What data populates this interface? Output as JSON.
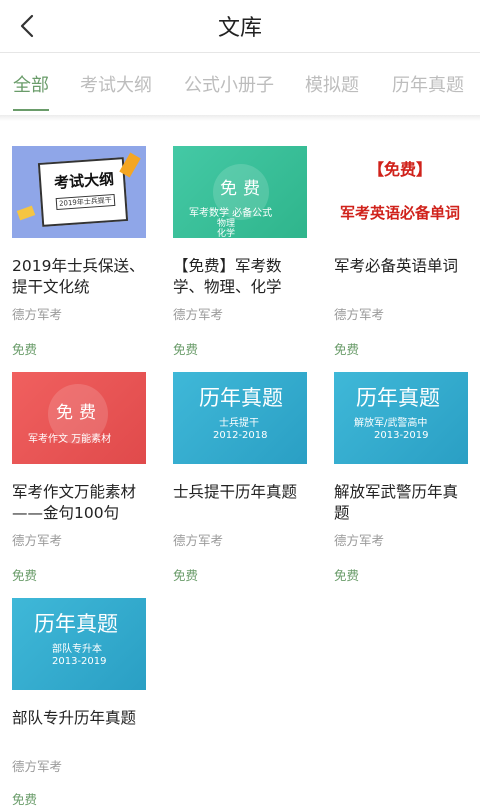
{
  "header": {
    "title": "文库"
  },
  "tabs": [
    {
      "label": "全部"
    },
    {
      "label": "考试大纲"
    },
    {
      "label": "公式小册子"
    },
    {
      "label": "模拟题"
    },
    {
      "label": "历年真题"
    }
  ],
  "items": [
    {
      "title": "2019年士兵保送、提干文化统",
      "publisher": "德方军考",
      "price": "免费",
      "cover": {
        "big": "考试大纲",
        "sub": "2019年士兵提干"
      }
    },
    {
      "title": "【免费】军考数学、物理、化学",
      "publisher": "德方军考",
      "price": "免费",
      "cover": {
        "big": "免费",
        "line1": "军考数学  必备公式",
        "line2": "物理",
        "line3": "化学"
      }
    },
    {
      "title": "军考必备英语单词",
      "publisher": "德方军考",
      "price": "免费",
      "cover": {
        "big": "【免费】",
        "sub": "军考英语必备单词"
      }
    },
    {
      "title": "军考作文万能素材——金句100句",
      "publisher": "德方军考",
      "price": "免费",
      "cover": {
        "big": "免费",
        "sub": "军考作文  万能素材"
      }
    },
    {
      "title": "士兵提干历年真题",
      "publisher": "德方军考",
      "price": "免费",
      "cover": {
        "big": "历年真题",
        "line1": "士兵提干",
        "line2": "2012-2018"
      }
    },
    {
      "title": "解放军武警历年真题",
      "publisher": "德方军考",
      "price": "免费",
      "cover": {
        "big": "历年真题",
        "line1": "解放军/武警高中",
        "line2": "2013-2019"
      }
    },
    {
      "title": "部队专升历年真题",
      "publisher": "德方军考",
      "price": "免费",
      "cover": {
        "big": "历年真题",
        "line1": "部队专升本",
        "line2": "2013-2019"
      }
    }
  ]
}
